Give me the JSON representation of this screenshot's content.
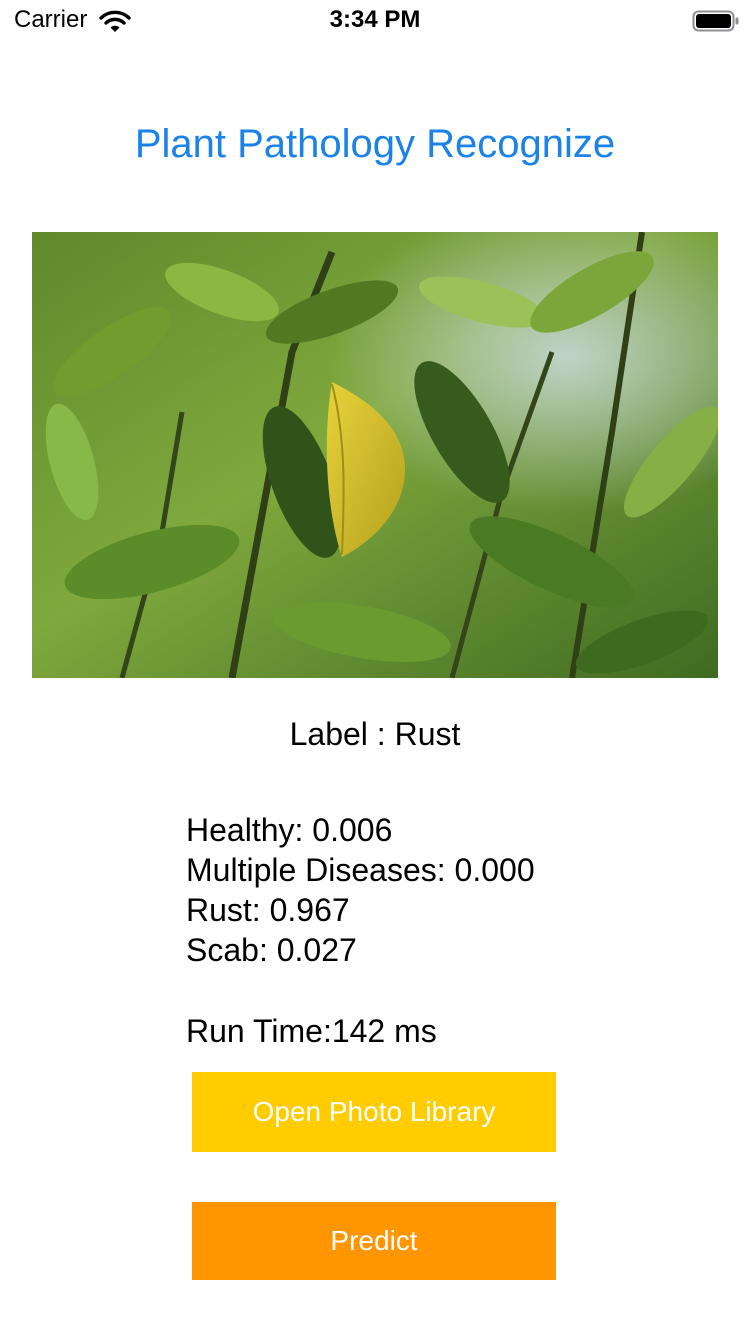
{
  "status_bar": {
    "carrier": "Carrier",
    "time": "3:34 PM",
    "wifi_icon": "wifi-icon",
    "battery_icon": "battery-icon"
  },
  "title": "Plant Pathology Recognize",
  "photo": {
    "subject": "leaf-photo"
  },
  "result": {
    "label_prefix": "Label : ",
    "label_value": "Rust"
  },
  "scores": [
    {
      "name": "Healthy",
      "value": "0.006"
    },
    {
      "name": "Multiple Diseases",
      "value": "0.000"
    },
    {
      "name": "Rust",
      "value": "0.967"
    },
    {
      "name": "Scab",
      "value": "0.027"
    }
  ],
  "runtime": {
    "prefix": "Run Time:",
    "value": "142",
    "unit": " ms"
  },
  "buttons": {
    "open_library": "Open Photo Library",
    "predict": "Predict"
  },
  "colors": {
    "title": "#1a82e8",
    "open_library_bg": "#ffcc00",
    "predict_bg": "#ff9500",
    "button_text": "#ffffff"
  }
}
